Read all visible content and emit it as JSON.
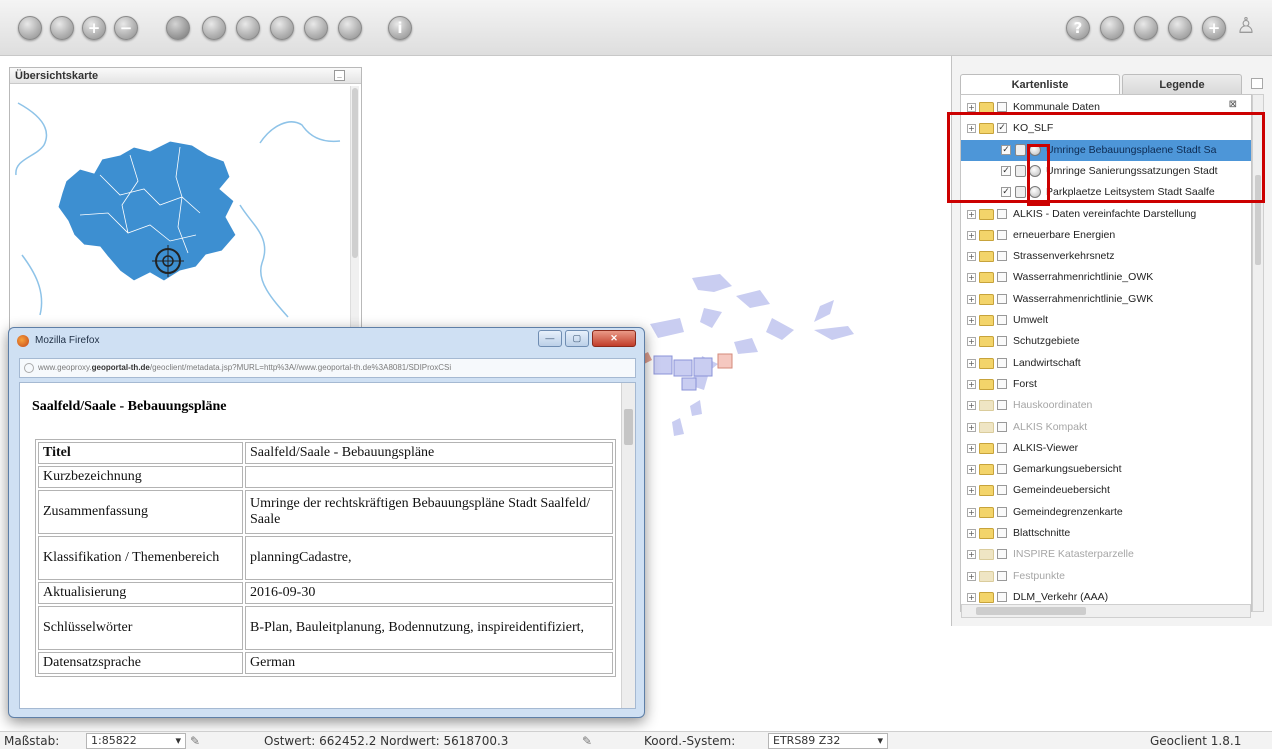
{
  "toolbar": {
    "left_buttons": [
      "zoom-in-box-icon",
      "zoom-extent-icon",
      "zoom-in-icon",
      "zoom-out-icon",
      "pan-icon",
      "back-icon",
      "forward-icon",
      "measure-icon",
      "select-icon",
      "edit-icon",
      "info-icon"
    ],
    "right_buttons": [
      "help-icon",
      "print-icon",
      "settings-icon",
      "save-icon",
      "add-icon",
      "user-icon"
    ],
    "help_glyph": "?",
    "info_glyph": "i",
    "plus_glyph": "+",
    "minus_glyph": "−",
    "user_glyph": "♙"
  },
  "overview": {
    "title": "Übersichtskarte",
    "map_fill": "#3d8fd1",
    "river_color": "#8ec3e8"
  },
  "layer_panel": {
    "tab_layers": "Kartenliste",
    "tab_legend": "Legende",
    "close_glyph": "⊠",
    "items": [
      {
        "label": "Kommunale Daten",
        "level": 0,
        "folder": true,
        "checked": false,
        "grey": false
      },
      {
        "label": "KO_SLF",
        "level": 0,
        "folder": true,
        "checked": true,
        "grey": false
      },
      {
        "label": "Umringe Bebauungsplaene Stadt Sa",
        "level": 1,
        "folder": false,
        "checked": true,
        "grey": false,
        "selected": true
      },
      {
        "label": "Umringe Sanierungssatzungen Stadt",
        "level": 1,
        "folder": false,
        "checked": true,
        "grey": false
      },
      {
        "label": "Parkplaetze Leitsystem Stadt Saalfe",
        "level": 1,
        "folder": false,
        "checked": true,
        "grey": false
      },
      {
        "label": "ALKIS - Daten vereinfachte Darstellung",
        "level": 0,
        "folder": true,
        "checked": false,
        "grey": false
      },
      {
        "label": "erneuerbare Energien",
        "level": 0,
        "folder": true,
        "checked": false,
        "grey": false
      },
      {
        "label": "Strassenverkehrsnetz",
        "level": 0,
        "folder": true,
        "checked": false,
        "grey": false
      },
      {
        "label": "Wasserrahmenrichtlinie_OWK",
        "level": 0,
        "folder": true,
        "checked": false,
        "grey": false
      },
      {
        "label": "Wasserrahmenrichtlinie_GWK",
        "level": 0,
        "folder": true,
        "checked": false,
        "grey": false
      },
      {
        "label": "Umwelt",
        "level": 0,
        "folder": true,
        "checked": false,
        "grey": false
      },
      {
        "label": "Schutzgebiete",
        "level": 0,
        "folder": true,
        "checked": false,
        "grey": false
      },
      {
        "label": "Landwirtschaft",
        "level": 0,
        "folder": true,
        "checked": false,
        "grey": false
      },
      {
        "label": "Forst",
        "level": 0,
        "folder": true,
        "checked": false,
        "grey": false
      },
      {
        "label": "Hauskoordinaten",
        "level": 0,
        "folder": true,
        "checked": false,
        "grey": true
      },
      {
        "label": "ALKIS Kompakt",
        "level": 0,
        "folder": true,
        "checked": false,
        "grey": true
      },
      {
        "label": "ALKIS-Viewer",
        "level": 0,
        "folder": true,
        "checked": false,
        "grey": false
      },
      {
        "label": "Gemarkungsuebersicht",
        "level": 0,
        "folder": true,
        "checked": false,
        "grey": false
      },
      {
        "label": "Gemeindeuebersicht",
        "level": 0,
        "folder": true,
        "checked": false,
        "grey": false
      },
      {
        "label": "Gemeindegrenzenkarte",
        "level": 0,
        "folder": true,
        "checked": false,
        "grey": false
      },
      {
        "label": "Blattschnitte",
        "level": 0,
        "folder": true,
        "checked": false,
        "grey": false
      },
      {
        "label": "INSPIRE Katasterparzelle",
        "level": 0,
        "folder": true,
        "checked": false,
        "grey": true
      },
      {
        "label": "Festpunkte",
        "level": 0,
        "folder": true,
        "checked": false,
        "grey": true
      },
      {
        "label": "DLM_Verkehr (AAA)",
        "level": 0,
        "folder": true,
        "checked": false,
        "grey": false
      }
    ]
  },
  "popup": {
    "window_title": "Mozilla Firefox",
    "url_prefix": "www.geoproxy.",
    "url_host": "geoportal-th.de",
    "url_rest": "/geoclient/metadata.jsp?MURL=http%3A//www.geoportal-th.de%3A8081/SDIProxCSi",
    "minimize": "—",
    "maximize": "▢",
    "close": "✕",
    "doc_title": "Saalfeld/Saale - Bebauungspläne",
    "rows": [
      {
        "key": "Titel",
        "value": "Saalfeld/Saale - Bebauungspläne",
        "bold": true
      },
      {
        "key": "Kurzbezeichnung",
        "value": ""
      },
      {
        "key": "Zusammenfassung",
        "value": "Umringe der rechtskräftigen Bebauungspläne Stadt Saalfeld/ Saale"
      },
      {
        "key": "Klassifikation / Themenbereich",
        "value": "planningCadastre,"
      },
      {
        "key": "Aktualisierung",
        "value": "2016-09-30"
      },
      {
        "key": "Schlüsselwörter",
        "value": "B-Plan, Bauleitplanung, Bodennutzung, inspireidentifiziert,"
      },
      {
        "key": "Datensatzsprache",
        "value": "German"
      }
    ]
  },
  "status": {
    "scale_label": "Maßstab:",
    "scale_value": "1:85822",
    "coords": "Ostwert: 662452.2 Nordwert: 5618700.3",
    "crs_label": "Koord.-System:",
    "crs_value": "ETRS89 Z32",
    "version": "Geoclient 1.8.1",
    "dropdown_glyph": "▾",
    "pencil_glyph": "✎"
  },
  "colors": {
    "highlight_red": "#cc0000",
    "selection_blue": "#4d96d8",
    "map_polygons": "#c9cdf1"
  }
}
